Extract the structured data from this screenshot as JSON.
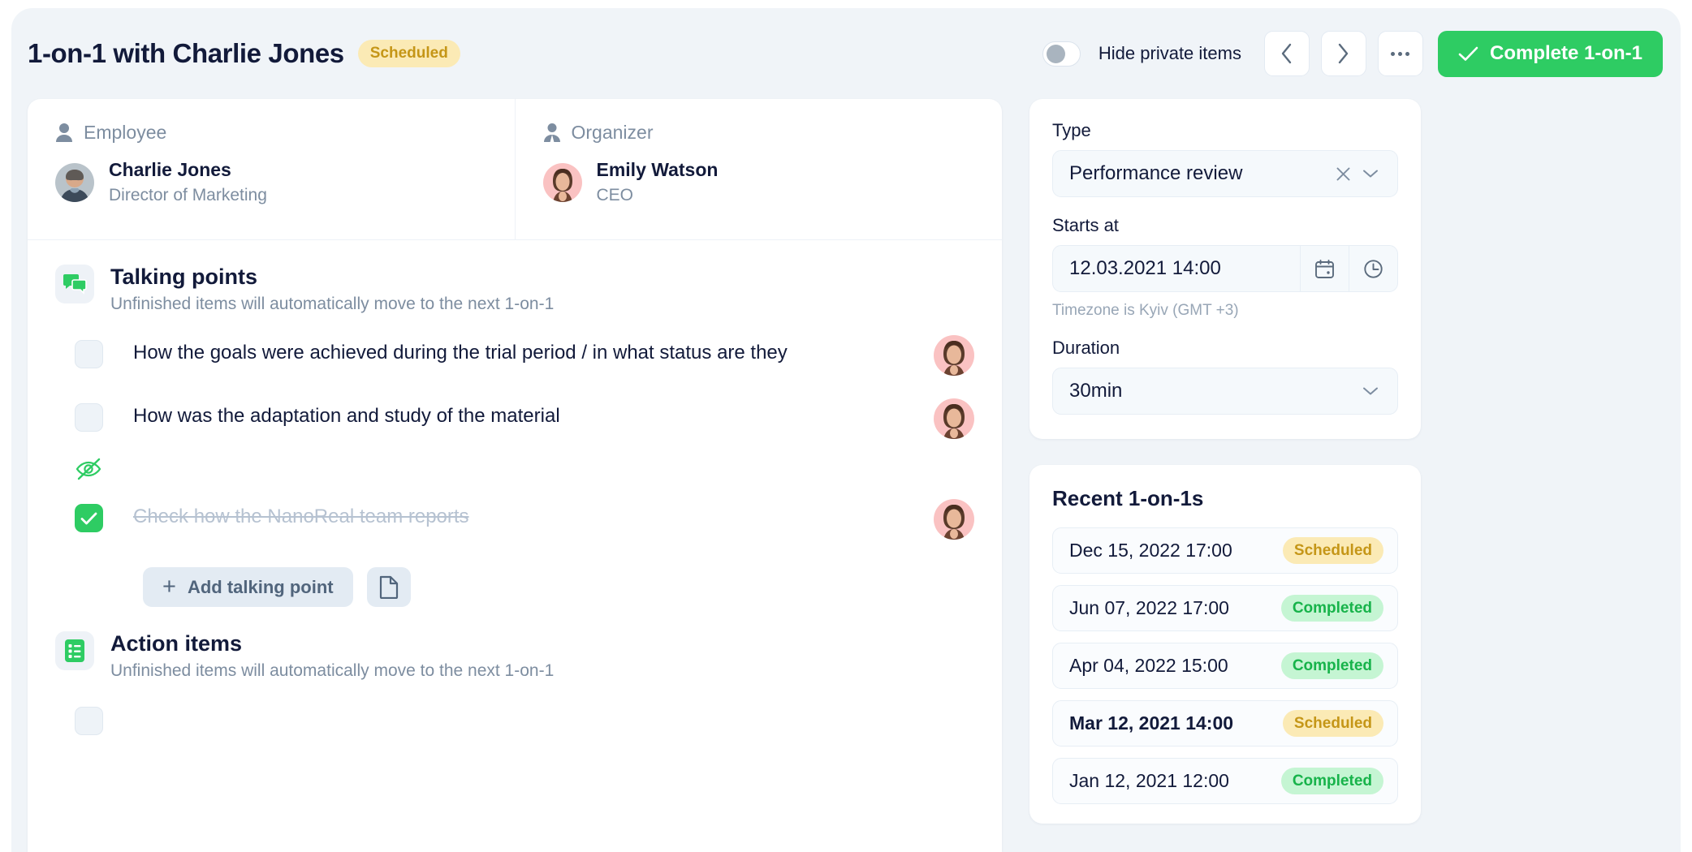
{
  "header": {
    "title": "1-on-1 with Charlie Jones",
    "status_badge": "Scheduled",
    "toggle_label": "Hide private items",
    "toggle_state": "off",
    "prev_label": "‹",
    "next_label": "›",
    "more_label": "…",
    "complete_label": "Complete 1-on-1"
  },
  "people": [
    {
      "role": "Employee",
      "role_icon": "person-icon",
      "name": "Charlie Jones",
      "title": "Director of Marketing"
    },
    {
      "role": "Organizer",
      "role_icon": "business-person-icon",
      "name": "Emily Watson",
      "title": "CEO"
    }
  ],
  "talking_points": {
    "icon": "speech-bubbles-icon",
    "title": "Talking points",
    "subtitle": "Unfinished items will automatically move to the next 1-on-1",
    "items": [
      {
        "text": "How the goals were achieved during the trial period / in what status are they",
        "checked": false,
        "private": false
      },
      {
        "text": "How was the adaptation and study of the material",
        "checked": false,
        "private": true
      },
      {
        "text": "Check how the NanoReal team reports",
        "checked": true,
        "private": false
      }
    ],
    "add_label": "Add talking point",
    "template_icon": "document-icon"
  },
  "action_items": {
    "icon": "checklist-icon",
    "title": "Action items",
    "subtitle": "Unfinished items will automatically move to the next 1-on-1"
  },
  "details": {
    "type_label": "Type",
    "type_value": "Performance review",
    "type_clear_icon": "close-icon",
    "type_chevron_icon": "chevron-down-icon",
    "starts_label": "Starts at",
    "starts_value": "12.03.2021 14:00",
    "calendar_icon": "calendar-icon",
    "clock_icon": "clock-icon",
    "timezone_hint": "Timezone is Kyiv (GMT +3)",
    "duration_label": "Duration",
    "duration_value": "30min",
    "duration_chevron_icon": "chevron-down-icon"
  },
  "recent": {
    "title": "Recent 1-on-1s",
    "items": [
      {
        "date": "Dec 15, 2022 17:00",
        "status": "Scheduled",
        "current": false
      },
      {
        "date": "Jun 07, 2022 17:00",
        "status": "Completed",
        "current": false
      },
      {
        "date": "Apr 04, 2022 15:00",
        "status": "Completed",
        "current": false
      },
      {
        "date": "Mar 12, 2021 14:00",
        "status": "Scheduled",
        "current": true
      },
      {
        "date": "Jan 12, 2021 12:00",
        "status": "Completed",
        "current": false
      }
    ]
  },
  "colors": {
    "accent_green": "#2ecc63",
    "scheduled_bg": "#fbeab5",
    "scheduled_fg": "#c59617",
    "completed_bg": "#c5f5d3",
    "completed_fg": "#17b34a",
    "text_dark": "#121a3a",
    "text_muted": "#7d8da0",
    "page_bg": "#f0f4f8"
  }
}
